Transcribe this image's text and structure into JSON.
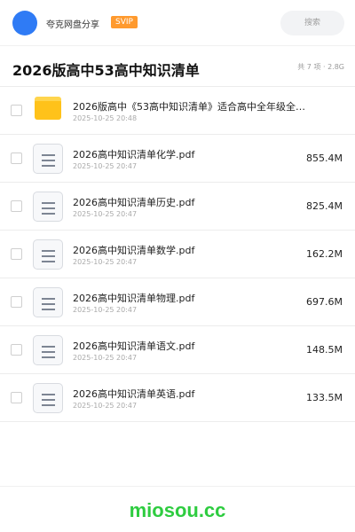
{
  "header": {
    "share_name": "夸克网盘分享",
    "badge": "SVIP",
    "search_placeholder": "搜索"
  },
  "folder": {
    "title": "2026版高中53高中知识清单",
    "summary": "共 7 项 · 2.8G"
  },
  "files": [
    {
      "name": "2026版高中《53高中知识清单》适合高中全年级全…",
      "date": "2025-10-25 20:48",
      "size": "",
      "icon": "folder-icon"
    },
    {
      "name": "2026高中知识清单化学.pdf",
      "date": "2025-10-25 20:47",
      "size": "855.4M",
      "icon": "document-icon"
    },
    {
      "name": "2026高中知识清单历史.pdf",
      "date": "2025-10-25 20:47",
      "size": "825.4M",
      "icon": "document-icon"
    },
    {
      "name": "2026高中知识清单数学.pdf",
      "date": "2025-10-25 20:47",
      "size": "162.2M",
      "icon": "document-icon"
    },
    {
      "name": "2026高中知识清单物理.pdf",
      "date": "2025-10-25 20:47",
      "size": "697.6M",
      "icon": "document-icon"
    },
    {
      "name": "2026高中知识清单语文.pdf",
      "date": "2025-10-25 20:47",
      "size": "148.5M",
      "icon": "document-icon"
    },
    {
      "name": "2026高中知识清单英语.pdf",
      "date": "2025-10-25 20:47",
      "size": "133.5M",
      "icon": "document-icon"
    }
  ],
  "footer": {
    "watermark": "miosou.cc"
  },
  "colors": {
    "avatar": "#2f7bf5",
    "badge": "#ff9a2e",
    "folder": "#ffc21a",
    "watermark": "#2ecc40"
  }
}
